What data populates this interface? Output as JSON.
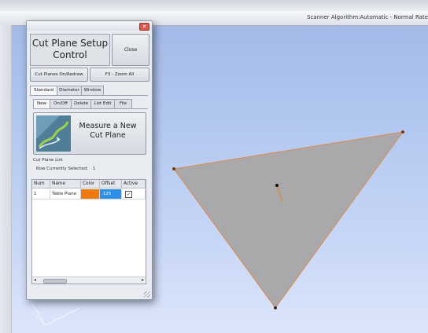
{
  "status": {
    "text": "Scanner Algorithm:Automatic - Normal  Rate"
  },
  "dialog": {
    "title": "Cut Plane Setup Control",
    "close_label": "Close",
    "cut_planes_label": "Cut Planes On/Redraw",
    "zoom_label": "F3 - Zoom All",
    "tabs": [
      "Standard",
      "Diameter",
      "Window"
    ],
    "subtabs": [
      "New",
      "On/Off",
      "Delete",
      "List Edit",
      "File"
    ],
    "measure_label": "Measure a New Cut Plane",
    "list_label": "Cut Plane List",
    "row_selected_label": "Row Currently Selected:",
    "row_selected_value": "1",
    "table": {
      "headers": [
        "Num",
        "Name",
        "Color",
        "Offset",
        "Active"
      ],
      "rows": [
        {
          "num": "1",
          "name": "Table Plane",
          "color": "#f07b0c",
          "offset": ".125",
          "active": true
        }
      ]
    }
  },
  "colors": {
    "plane_fill": "#a9a9ab",
    "plane_edge": "#e08a4a",
    "normal_vector": "#e0892f",
    "offset_cell": "#2e8fe8"
  }
}
